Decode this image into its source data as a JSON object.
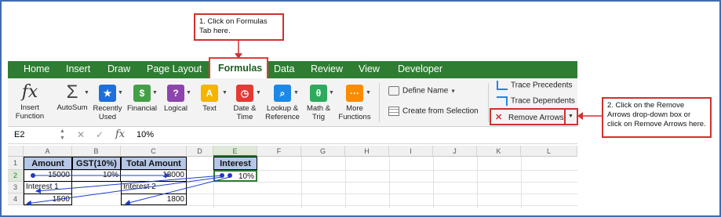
{
  "ribbon_tabs": [
    "Home",
    "Insert",
    "Draw",
    "Page Layout",
    "Formulas",
    "Data",
    "Review",
    "View",
    "Developer"
  ],
  "active_tab": "Formulas",
  "ribbon": {
    "insert_function": {
      "line1": "Insert",
      "line2": "Function",
      "icon": "fx-icon"
    },
    "autosum": {
      "line1": "AutoSum",
      "icon": "sigma-icon"
    },
    "recently_used": {
      "line1": "Recently",
      "line2": "Used",
      "icon": "star-icon"
    },
    "financial": {
      "line1": "Financial",
      "icon": "financial-icon"
    },
    "logical": {
      "line1": "Logical",
      "icon": "question-icon"
    },
    "text": {
      "line1": "Text",
      "icon": "text-icon"
    },
    "date_time": {
      "line1": "Date &",
      "line2": "Time",
      "icon": "clock-icon"
    },
    "lookup_reference": {
      "line1": "Lookup &",
      "line2": "Reference",
      "icon": "lookup-icon"
    },
    "math_trig": {
      "line1": "Math &",
      "line2": "Trig",
      "icon": "theta-icon"
    },
    "more_functions": {
      "line1": "More",
      "line2": "Functions",
      "icon": "more-icon"
    },
    "define_name": "Define Name",
    "create_from_selection": "Create from Selection",
    "trace_precedents": "Trace Precedents",
    "trace_dependents": "Trace Dependents",
    "remove_arrows": "Remove Arrows"
  },
  "formula_bar": {
    "name_box": "E2",
    "fx": "fx",
    "value": "10%"
  },
  "columns": [
    "A",
    "B",
    "C",
    "D",
    "E",
    "F",
    "G",
    "H",
    "I",
    "J",
    "K",
    "L"
  ],
  "rows": [
    "1",
    "2",
    "3",
    "4"
  ],
  "cells": {
    "A1": "Amount",
    "B1": "GST(10%)",
    "C1": "Total Amount",
    "E1": "Interest",
    "A2": "15000",
    "B2": "10%",
    "C2": "18000",
    "E2": "10%",
    "A3": "Interest 1",
    "C3": "Interest 2",
    "A4": "1500",
    "C4": "1800"
  },
  "callouts": {
    "step1": "1. Click on Formulas Tab here.",
    "step2": "2. Click on the Remove Arrows drop-down box or click on Remove Arrows here."
  },
  "colors": {
    "tab_bar": "#2e7d32",
    "callout_border": "#d32f2f",
    "header_fill": "#b4c7e7",
    "arrow": "#1e3cc8"
  }
}
